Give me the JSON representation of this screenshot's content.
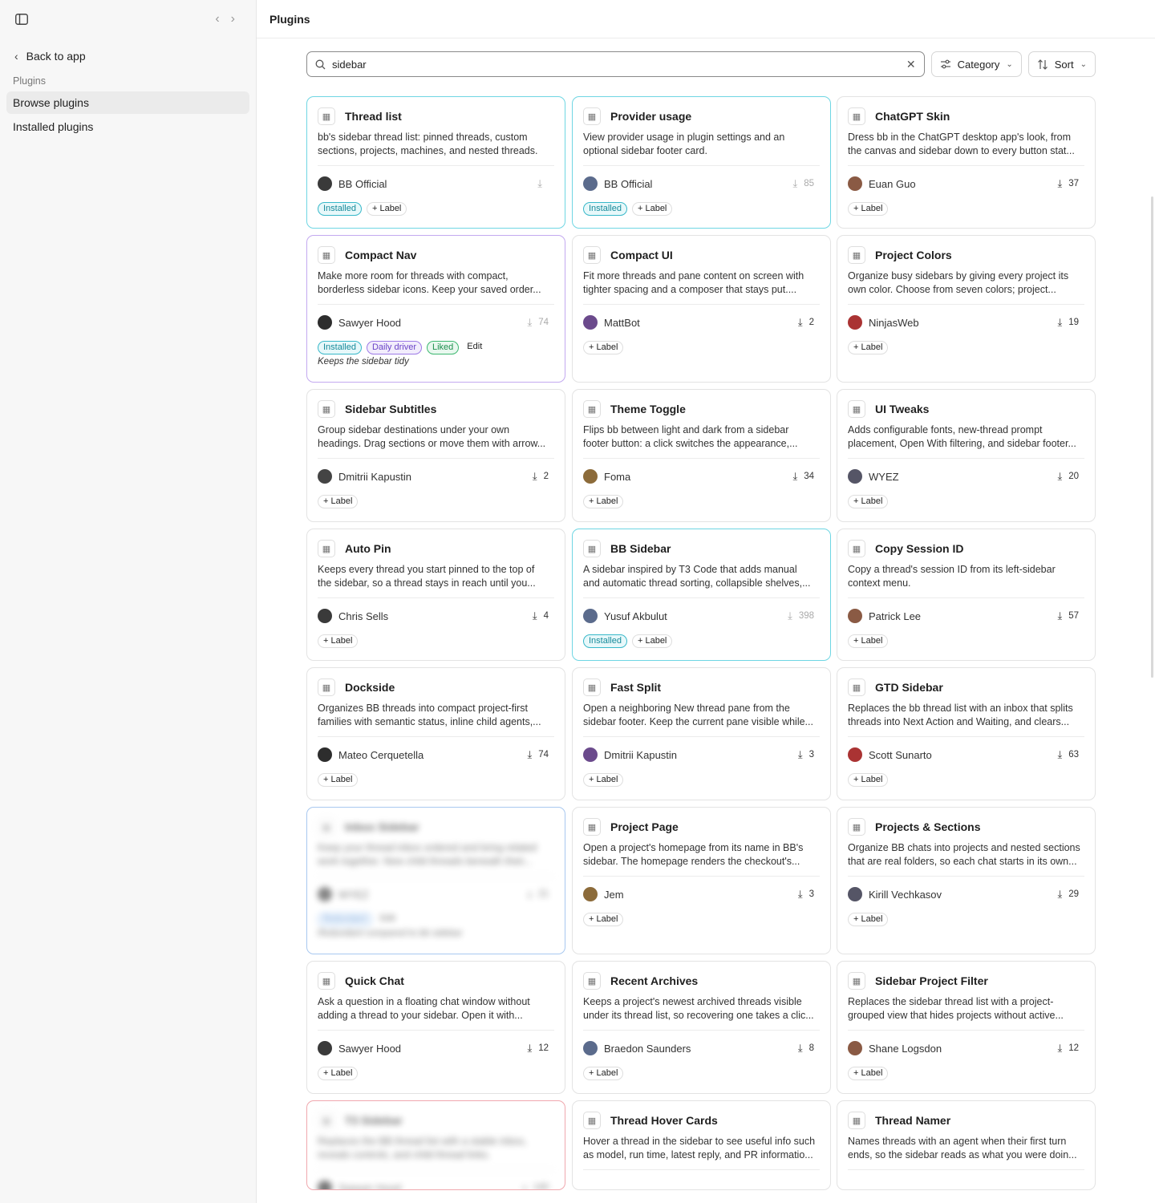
{
  "sidebar": {
    "back_label": "Back to app",
    "section_label": "Plugins",
    "items": [
      {
        "label": "Browse plugins",
        "active": true
      },
      {
        "label": "Installed plugins",
        "active": false
      }
    ]
  },
  "header": {
    "title": "Plugins"
  },
  "toolbar": {
    "search_value": "sidebar",
    "category_label": "Category",
    "sort_label": "Sort"
  },
  "colors": {
    "installed": "#37b8c9",
    "daily_driver": "#9d7ae6",
    "liked": "#3db870",
    "redundant": "#6aa4e8"
  },
  "plugins": [
    {
      "name": "Thread list",
      "icon": "list-icon",
      "desc1": "bb's sidebar thread list: pinned threads, custom",
      "desc2": "sections, projects, machines, and nested threads.",
      "author": "BB Official",
      "downloads": "",
      "tags": [
        "Installed",
        "+ Label"
      ],
      "style": "installed"
    },
    {
      "name": "Provider usage",
      "icon": "chart-icon",
      "desc1": "View provider usage in plugin settings and an",
      "desc2": "optional sidebar footer card.",
      "author": "BB Official",
      "downloads": "85",
      "tags": [
        "Installed",
        "+ Label"
      ],
      "style": "installed"
    },
    {
      "name": "ChatGPT Skin",
      "icon": "palette-icon",
      "desc1": "Dress bb in the ChatGPT desktop app's look, from",
      "desc2": "the canvas and sidebar down to every button stat...",
      "author": "Euan Guo",
      "downloads": "37",
      "tags": [
        "+ Label"
      ],
      "style": ""
    },
    {
      "name": "Compact Nav",
      "icon": "compact-icon",
      "desc1": "Make more room for threads with compact,",
      "desc2": "borderless sidebar icons. Keep your saved order...",
      "author": "Sawyer Hood",
      "downloads": "74",
      "tags": [
        "Installed",
        "Daily driver",
        "Liked",
        "Edit"
      ],
      "note": "Keeps the sidebar tidy",
      "style": "purple"
    },
    {
      "name": "Compact UI",
      "icon": "sliders-icon",
      "desc1": "Fit more threads and pane content on screen with",
      "desc2": "tighter spacing and a composer that stays put....",
      "author": "MattBot",
      "downloads": "2",
      "tags": [
        "+ Label"
      ],
      "style": ""
    },
    {
      "name": "Project Colors",
      "icon": "color-swatch-icon",
      "desc1": "Organize busy sidebars by giving every project its",
      "desc2": "own color. Choose from seven colors; project...",
      "author": "NinjasWeb",
      "downloads": "19",
      "tags": [
        "+ Label"
      ],
      "style": ""
    },
    {
      "name": "Sidebar Subtitles",
      "icon": "subtitles-icon",
      "desc1": "Group sidebar destinations under your own",
      "desc2": "headings. Drag sections or move them with arrow...",
      "author": "Dmitrii Kapustin",
      "downloads": "2",
      "tags": [
        "+ Label"
      ],
      "style": ""
    },
    {
      "name": "Theme Toggle",
      "icon": "theme-icon",
      "desc1": "Flips bb between light and dark from a sidebar",
      "desc2": "footer button: a click switches the appearance,...",
      "author": "Foma",
      "downloads": "34",
      "tags": [
        "+ Label"
      ],
      "style": ""
    },
    {
      "name": "UI Tweaks",
      "icon": "tweaks-icon",
      "desc1": "Adds configurable fonts, new-thread prompt",
      "desc2": "placement, Open With filtering, and sidebar footer...",
      "author": "WYEZ",
      "downloads": "20",
      "tags": [
        "+ Label"
      ],
      "style": ""
    },
    {
      "name": "Auto Pin",
      "icon": "pin-icon",
      "desc1": "Keeps every thread you start pinned to the top of",
      "desc2": "the sidebar, so a thread stays in reach until you...",
      "author": "Chris Sells",
      "downloads": "4",
      "tags": [
        "+ Label"
      ],
      "style": ""
    },
    {
      "name": "BB Sidebar",
      "icon": "sidebar-icon",
      "desc1": "A sidebar inspired by T3 Code that adds manual",
      "desc2": "and automatic thread sorting, collapsible shelves,...",
      "author": "Yusuf Akbulut",
      "downloads": "398",
      "tags": [
        "Installed",
        "+ Label"
      ],
      "style": "installed"
    },
    {
      "name": "Copy Session ID",
      "icon": "copy-icon",
      "desc1": "Copy a thread's session ID from its left-sidebar",
      "desc2": "context menu.",
      "author": "Patrick Lee",
      "downloads": "57",
      "tags": [
        "+ Label"
      ],
      "style": ""
    },
    {
      "name": "Dockside",
      "icon": "sidebar-icon",
      "desc1": "Organizes BB threads into compact project-first",
      "desc2": "families with semantic status, inline child agents,...",
      "author": "Mateo Cerquetella",
      "downloads": "74",
      "tags": [
        "+ Label"
      ],
      "style": ""
    },
    {
      "name": "Fast Split",
      "icon": "split-icon",
      "desc1": "Open a neighboring New thread pane from the",
      "desc2": "sidebar footer. Keep the current pane visible while...",
      "author": "Dmitrii Kapustin",
      "downloads": "3",
      "tags": [
        "+ Label"
      ],
      "style": ""
    },
    {
      "name": "GTD Sidebar",
      "icon": "sidebar-icon",
      "desc1": "Replaces the bb thread list with an inbox that splits",
      "desc2": "threads into Next Action and Waiting, and clears...",
      "author": "Scott Sunarto",
      "downloads": "63",
      "tags": [
        "+ Label"
      ],
      "style": ""
    },
    {
      "name": "Inbox Sidebar",
      "icon": "inbox-icon",
      "desc1": "Keep your thread inbox ordered and bring related",
      "desc2": "work together. New child threads beneath their...",
      "author": "WYEZ",
      "downloads": "21",
      "tags": [
        "Redundant",
        "Edit"
      ],
      "note": "Redundant compared to bb sidebar",
      "style": "blue",
      "blurred": true
    },
    {
      "name": "Project Page",
      "icon": "folder-icon",
      "desc1": "Open a project's homepage from its name in BB's",
      "desc2": "sidebar. The homepage renders the checkout's...",
      "author": "Jem",
      "downloads": "3",
      "tags": [
        "+ Label"
      ],
      "style": ""
    },
    {
      "name": "Projects & Sections",
      "icon": "sections-icon",
      "desc1": "Organize BB chats into projects and nested sections",
      "desc2": "that are real folders, so each chat starts in its own...",
      "author": "Kirill Vechkasov",
      "downloads": "29",
      "tags": [
        "+ Label"
      ],
      "style": ""
    },
    {
      "name": "Quick Chat",
      "icon": "chat-icon",
      "desc1": "Ask a question in a floating chat window without",
      "desc2": "adding a thread to your sidebar. Open it with...",
      "author": "Sawyer Hood",
      "downloads": "12",
      "tags": [
        "+ Label"
      ],
      "style": ""
    },
    {
      "name": "Recent Archives",
      "icon": "archive-icon",
      "desc1": "Keeps a project's newest archived threads visible",
      "desc2": "under its thread list, so recovering one takes a clic...",
      "author": "Braedon Saunders",
      "downloads": "8",
      "tags": [
        "+ Label"
      ],
      "style": ""
    },
    {
      "name": "Sidebar Project Filter",
      "icon": "filter-icon",
      "desc1": "Replaces the sidebar thread list with a project-",
      "desc2": "grouped view that hides projects without active...",
      "author": "Shane Logsdon",
      "downloads": "12",
      "tags": [
        "+ Label"
      ],
      "style": ""
    },
    {
      "name": "T3 Sidebar",
      "icon": "sidebar-icon",
      "desc1": "Replaces the BB thread list with a stable inbox,",
      "desc2": "reveals controls, and child thread links.",
      "author": "Sawyer Hood",
      "downloads": "140",
      "tags": [],
      "style": "red",
      "blurred": true
    },
    {
      "name": "Thread Hover Cards",
      "icon": "hover-card-icon",
      "desc1": "Hover a thread in the sidebar to see useful info such",
      "desc2": "as model, run time, latest reply, and PR informatio...",
      "author": "",
      "downloads": "",
      "tags": [],
      "style": ""
    },
    {
      "name": "Thread Namer",
      "icon": "namer-icon",
      "desc1": "Names threads with an agent when their first turn",
      "desc2": "ends, so the sidebar reads as what you were doin...",
      "author": "",
      "downloads": "",
      "tags": [],
      "style": ""
    }
  ]
}
